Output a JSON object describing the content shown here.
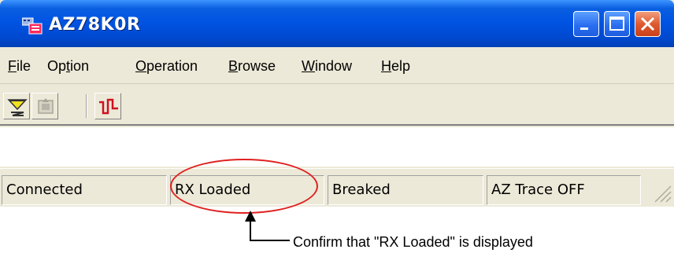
{
  "window": {
    "title": "AZ78K0R",
    "icon": "app-icon",
    "controls": [
      "minimize-icon",
      "maximize-icon",
      "close-icon"
    ],
    "title_color": "#0054e3"
  },
  "menu": {
    "items": [
      {
        "accel": "F",
        "rest": "ile"
      },
      {
        "pre": "Op",
        "accel": "t",
        "rest": "ion"
      },
      {
        "accel": "O",
        "rest": "peration"
      },
      {
        "accel": "B",
        "rest": "rowse"
      },
      {
        "accel": "W",
        "rest": "indow"
      },
      {
        "accel": "H",
        "rest": "elp"
      }
    ]
  },
  "toolbar": {
    "buttons": [
      "download-icon",
      "upload-disabled-icon",
      "signal-trace-icon"
    ]
  },
  "status": {
    "panes": [
      "Connected",
      "RX Loaded",
      "Breaked",
      "AZ Trace OFF"
    ]
  },
  "annotation": {
    "text": "Confirm that \"RX Loaded\" is displayed",
    "color": "#e02020"
  }
}
